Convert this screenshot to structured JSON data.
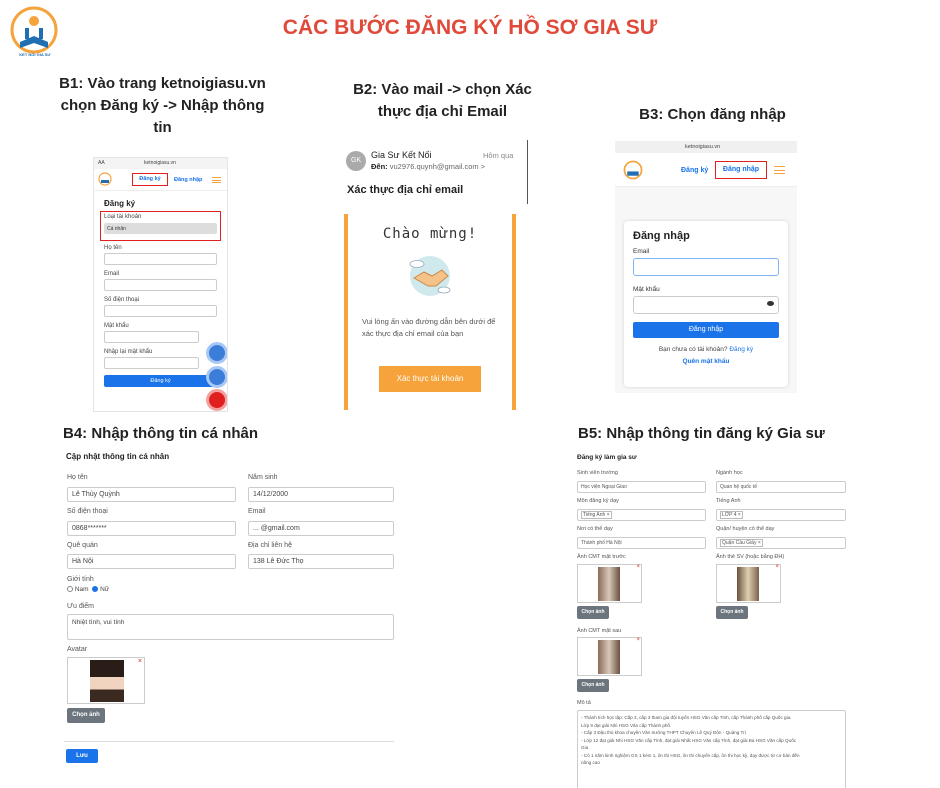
{
  "header": {
    "title": "CÁC BƯỚC ĐĂNG KÝ HỒ SƠ GIA SƯ",
    "logo_caption": "KẾT NỐI GIA SƯ"
  },
  "steps": {
    "b1": "B1: Vào trang ketnoigiasu.vn chọn Đăng ký -> Nhập thông tin",
    "b2": "B2: Vào mail -> chọn Xác thực địa chỉ Email",
    "b3": "B3: Chọn đăng nhập",
    "b4": "B4: Nhập thông tin cá nhân",
    "b5": "B5: Nhập thông tin đăng ký Gia sư"
  },
  "s1": {
    "url": "ketnoigiasu.vn",
    "aa": "AA",
    "nav_register": "Đăng ký",
    "nav_login": "Đăng nhập",
    "form_title": "Đăng ký",
    "account_type_label": "Loại tài khoản",
    "account_type_value": "Cá nhân",
    "name_label": "Họ tên",
    "email_label": "Email",
    "phone_label": "Số điện thoại",
    "password_label": "Mật khẩu",
    "confirm_label": "Nhập lại mật khẩu",
    "submit": "Đăng ký"
  },
  "s2": {
    "avatar": "GK",
    "sender": "Gia Sư Kết Nối",
    "time": "Hôm qua",
    "to_label": "Đến:",
    "to_value": "vu2976.quynh@gmail.com >",
    "subject": "Xác thực địa chỉ email",
    "welcome": "Chào mừng!",
    "body": "Vui lòng ấn vào đường dẫn bên dưới để xác thực địa chỉ email của bạn",
    "button": "Xác thực tài khoản"
  },
  "s3": {
    "url": "ketnoigiasu.vn",
    "nav_register": "Đăng ký",
    "nav_login": "Đăng nhập",
    "form_title": "Đăng nhập",
    "email_label": "Email",
    "password_label": "Mật khẩu",
    "submit": "Đăng nhập",
    "no_account": "Bạn chưa có tài khoản?",
    "register_link": "Đăng ký",
    "forgot": "Quên mật khẩu"
  },
  "s4": {
    "heading": "Cập nhật thông tin cá nhân",
    "name_label": "Họ tên",
    "name_value": "Lê Thùy Quỳnh",
    "birth_label": "Năm sinh",
    "birth_value": "14/12/2000",
    "phone_label": "Số điện thoại",
    "phone_value": "0868*******",
    "email_label": "Email",
    "email_value": "... @gmail.com",
    "home_label": "Quê quán",
    "home_value": "Hà Nội",
    "address_label": "Địa chỉ liên hệ",
    "address_value": "138 Lê Đức Thọ",
    "gender_label": "Giới tính",
    "male": "Nam",
    "female": "Nữ",
    "strengths_label": "Ưu điểm",
    "strengths_value": "Nhiệt tình, vui tính",
    "avatar_label": "Avatar",
    "choose_photo": "Chọn ảnh",
    "save": "Lưu"
  },
  "s5": {
    "heading": "Đăng ký làm gia sư",
    "student_label": "Sinh viên trường",
    "student_value": "Học viện Ngoại Giao",
    "major_label": "Ngành học",
    "major_value": "Quan hệ quốc tế",
    "subject_label": "Môn đăng ký dạy",
    "subject_value": "Tiếng Anh ×",
    "subject2_label": "Tiếng Anh",
    "subject2_value": "LỚP 4 ×",
    "place_label": "Nơi có thể dạy",
    "place_value": "Thành phố Hà Nội",
    "district_label": "Quận/ huyện có thể dạy",
    "district_value": "Quận Cầu Giấy ×",
    "id_front_label": "Ảnh CMT mặt trước",
    "card_label": "Ảnh thẻ SV (hoặc bằng ĐH)",
    "id_back_label": "Ảnh CMT mặt sau",
    "choose_photo": "Chọn ảnh",
    "desc_label": "Mô tả",
    "desc_lines": [
      "- Thành tích học tập: Cấp 2, cấp 3 tham gia đội tuyển HSG Văn cấp Tỉnh, cấp Thành phố cấp Quốc gia.",
      "Lớp 9 đạt giải Nhì HSG Văn cấp Thành phố.",
      "- Cấp 3 Đậu thủ khoa chuyên Văn trường THPT Chuyên Lê Quý Đôn - Quảng Trị",
      "- Lớp 12 đạt giải Nhì HSG Văn cấp Tỉnh, đạt giải Nhất HSG Văn cấp Tỉnh, đạt giải Ba HSG Văn cấp Quốc",
      "Gia",
      "- Có 1 năm kinh nghiệm GS 1 kèm 1, ôn thi HSG, ôn thi chuyển cấp, ôn thi học kỳ, dạy được từ cơ bản đến",
      "nâng cao"
    ]
  },
  "colors": {
    "title": "#e04a3a",
    "blue": "#1a73e8",
    "orange": "#f5a33a",
    "red_box": "#e02020"
  }
}
